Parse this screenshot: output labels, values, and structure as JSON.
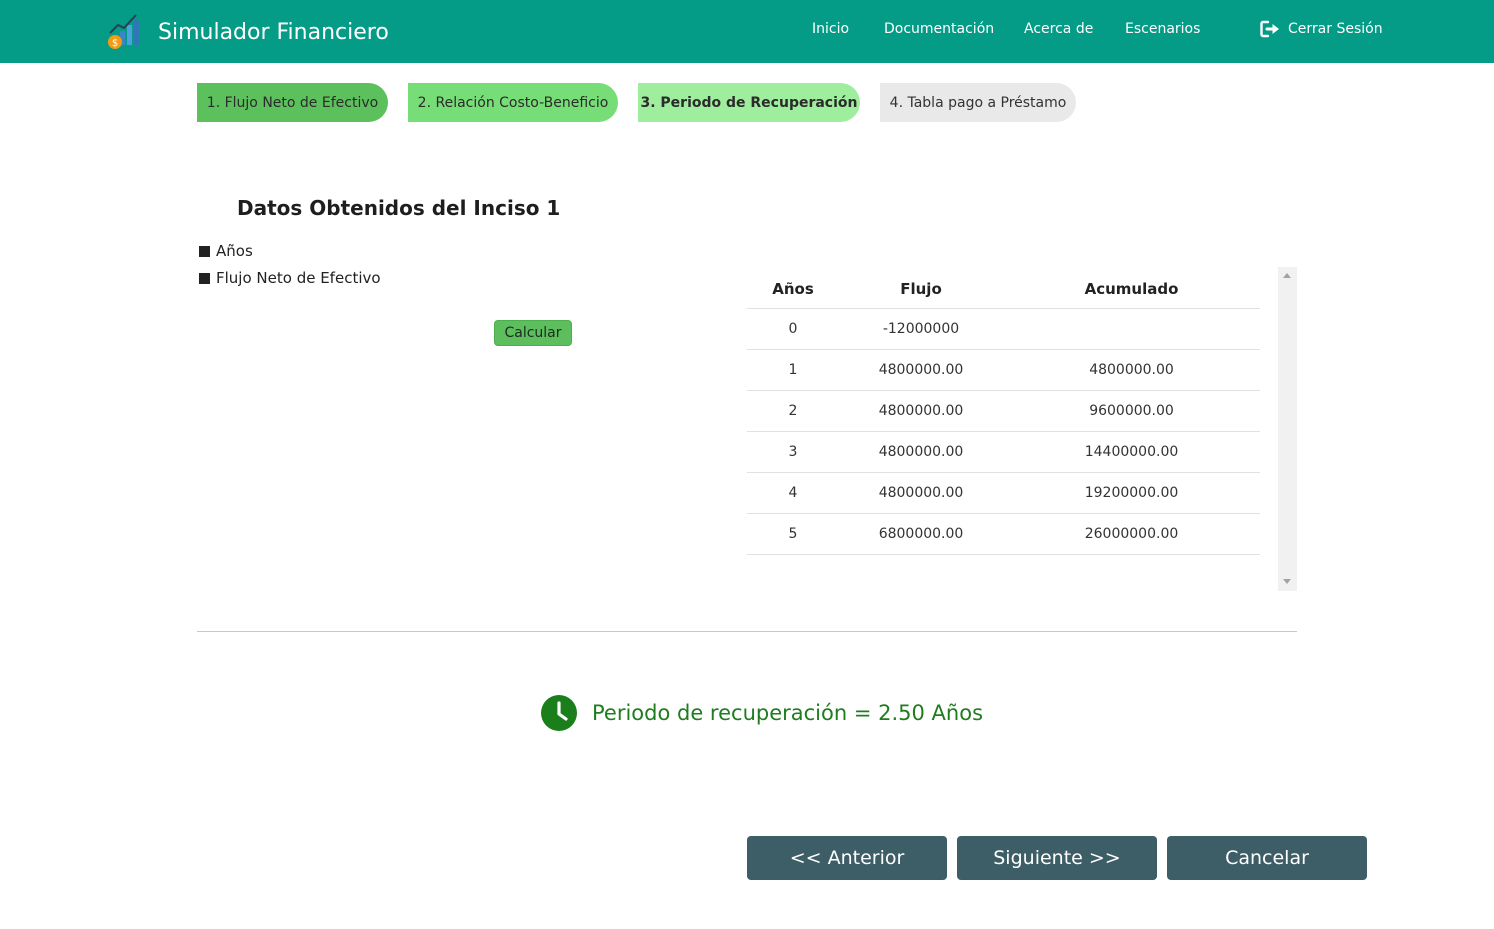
{
  "header": {
    "title": "Simulador Financiero",
    "nav": [
      "Inicio",
      "Documentación",
      "Acerca de",
      "Escenarios"
    ],
    "logout": "Cerrar Sesión",
    "logo_icon": "chart-coin-logo",
    "logout_icon": "sign-out-icon"
  },
  "steps": [
    {
      "label": "1. Flujo Neto de Efectivo",
      "color": "#5cc15c",
      "state": "done"
    },
    {
      "label": "2. Relación Costo-Beneficio",
      "color": "#77dd77",
      "state": "done"
    },
    {
      "label": "3. Periodo de Recuperación",
      "color": "#9eee9e",
      "state": "active"
    },
    {
      "label": "4. Tabla pago a Préstamo",
      "color": "#e9e9e9",
      "state": "pending"
    }
  ],
  "section": {
    "title": "Datos Obtenidos del Inciso 1",
    "legend": [
      "Años",
      "Flujo Neto de Efectivo"
    ],
    "calculate_label": "Calcular"
  },
  "table": {
    "headers": [
      "Años",
      "Flujo",
      "Acumulado"
    ],
    "rows": [
      [
        "0",
        "-12000000",
        ""
      ],
      [
        "1",
        "4800000.00",
        "4800000.00"
      ],
      [
        "2",
        "4800000.00",
        "9600000.00"
      ],
      [
        "3",
        "4800000.00",
        "14400000.00"
      ],
      [
        "4",
        "4800000.00",
        "19200000.00"
      ],
      [
        "5",
        "6800000.00",
        "26000000.00"
      ]
    ]
  },
  "result": {
    "text": "Periodo de recuperación = 2.50 Años",
    "icon": "clock-icon",
    "color": "#1f7d1f"
  },
  "buttons": {
    "previous": "<< Anterior",
    "next": "Siguiente >>",
    "cancel": "Cancelar"
  },
  "colors": {
    "navbar": "#049b87",
    "button_dark": "#3d5d67",
    "calculate": "#5cbe5c"
  }
}
